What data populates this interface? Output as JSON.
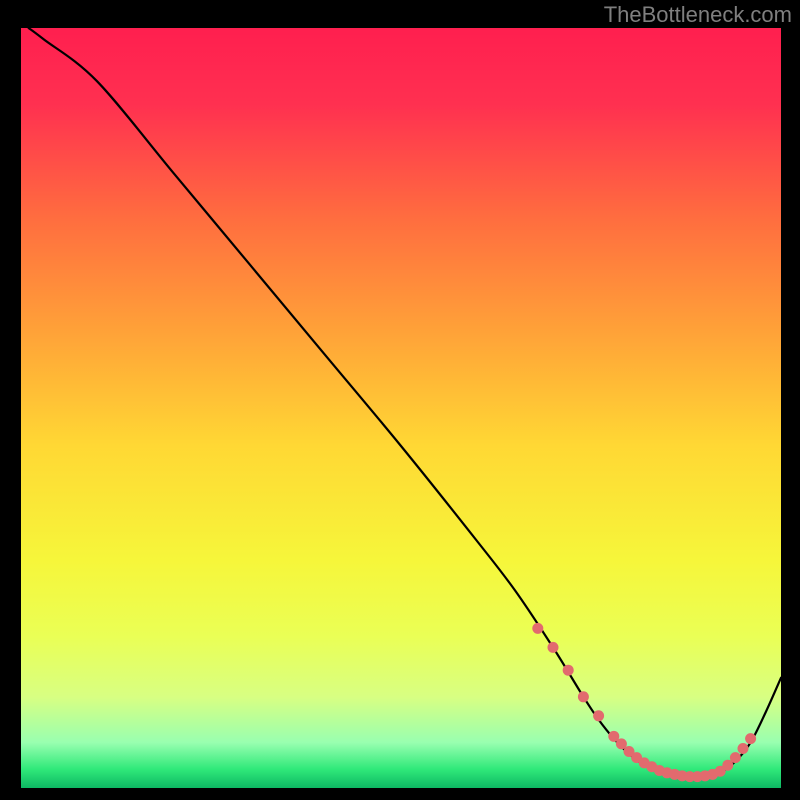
{
  "watermark": "TheBottleneck.com",
  "chart_data": {
    "type": "line",
    "title": "",
    "xlabel": "",
    "ylabel": "",
    "xlim": [
      0,
      100
    ],
    "ylim": [
      0,
      100
    ],
    "series": [
      {
        "name": "bottleneck-curve",
        "x": [
          1,
          3,
          10,
          20,
          30,
          40,
          50,
          60,
          65,
          70,
          74,
          76,
          78,
          80,
          82,
          84,
          86,
          88,
          90,
          92,
          94,
          96,
          98,
          100
        ],
        "y": [
          100,
          98.5,
          93,
          81,
          69,
          57,
          45,
          32.5,
          26,
          18.5,
          12,
          9,
          6.5,
          4.5,
          3,
          2,
          1.5,
          1.3,
          1.4,
          2,
          3.5,
          6,
          10,
          14.5
        ]
      }
    ],
    "markers": {
      "note": "pink dotted segment approximating the data-point cluster along the valley",
      "x": [
        68,
        70,
        72,
        74,
        76,
        78,
        79,
        80,
        81,
        82,
        83,
        84,
        85,
        86,
        87,
        88,
        89,
        90,
        91,
        92,
        93,
        94,
        95,
        96
      ],
      "y": [
        21,
        18.5,
        15.5,
        12,
        9.5,
        6.8,
        5.8,
        4.8,
        4,
        3.3,
        2.8,
        2.3,
        2,
        1.8,
        1.6,
        1.5,
        1.5,
        1.6,
        1.8,
        2.2,
        3,
        4,
        5.2,
        6.5
      ]
    },
    "background_gradient": {
      "stops": [
        {
          "offset": 0.0,
          "color": "#ff1f4f"
        },
        {
          "offset": 0.1,
          "color": "#ff3050"
        },
        {
          "offset": 0.25,
          "color": "#ff6d3f"
        },
        {
          "offset": 0.4,
          "color": "#ffa238"
        },
        {
          "offset": 0.55,
          "color": "#ffd834"
        },
        {
          "offset": 0.7,
          "color": "#f6f63a"
        },
        {
          "offset": 0.8,
          "color": "#eaff55"
        },
        {
          "offset": 0.88,
          "color": "#d8ff82"
        },
        {
          "offset": 0.94,
          "color": "#99ffb0"
        },
        {
          "offset": 0.975,
          "color": "#30e97a"
        },
        {
          "offset": 1.0,
          "color": "#0db863"
        }
      ]
    }
  }
}
